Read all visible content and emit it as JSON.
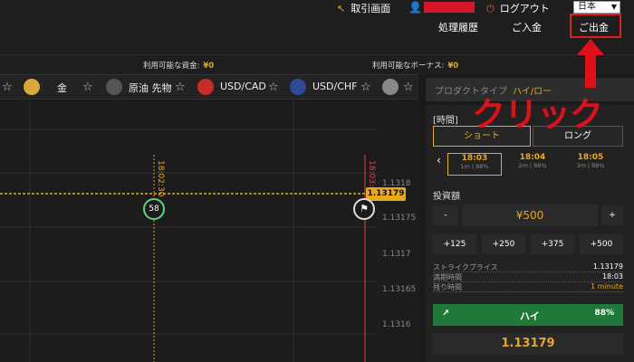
{
  "header": {
    "trade_screen": "取引画面",
    "logout": "ログアウト",
    "language": "日本",
    "history": "処理履歴",
    "deposit": "ご入金",
    "withdraw": "ご出金"
  },
  "annotation": {
    "click_text": "クリック",
    "color": "#e0101a"
  },
  "balance": {
    "available_funds_label": "利用可能な資金:",
    "available_funds_value": "¥0",
    "available_bonus_label": "利用可能なボーナス:",
    "available_bonus_value": "¥0"
  },
  "assets": [
    {
      "label": "金",
      "icon": "gold-coin-icon"
    },
    {
      "label": "原油 先物",
      "icon": "oil-futures-icon"
    },
    {
      "label": "USD/CAD",
      "icon": "usd-cad-flag-icon"
    },
    {
      "label": "USD/CHF",
      "icon": "usd-chf-flag-icon"
    }
  ],
  "chart": {
    "current_price": "1.13179",
    "y_ticks": [
      "1.1318",
      "1.13175",
      "1.1317",
      "1.13165",
      "1.1316"
    ],
    "vertical_label_1": "18:02:30",
    "vertical_label_2": "18:03:00",
    "timer_value": "58"
  },
  "panel": {
    "product_type_label": "プロダクトタイプ",
    "product_type_value": "ハイ/ロー",
    "time_label": "[時間]",
    "tab_short": "ショート",
    "tab_long": "ロング",
    "time_options": [
      {
        "time": "18:03",
        "sub": "1m | 88%"
      },
      {
        "time": "18:04",
        "sub": "2m | 88%"
      },
      {
        "time": "18:05",
        "sub": "3m | 88%"
      }
    ],
    "investment_label": "投資額",
    "minus": "-",
    "plus": "+",
    "amount": "¥500",
    "quick_amounts": [
      "+125",
      "+250",
      "+375",
      "+500"
    ],
    "strike_label": "ストライクプライス",
    "strike_value": "1.13179",
    "expiry_label": "満期時間",
    "expiry_value": "18:03",
    "remaining_label": "残り時間",
    "remaining_value": "1 minute",
    "high_label": "ハイ",
    "high_payout": "88%",
    "price_display": "1.13179"
  }
}
